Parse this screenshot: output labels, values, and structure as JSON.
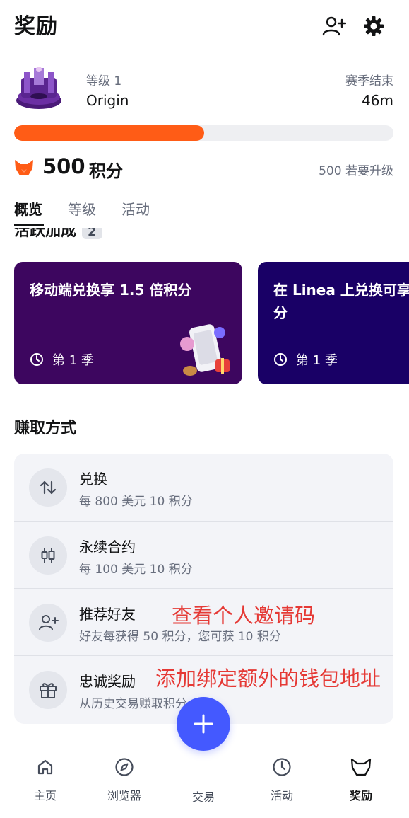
{
  "header": {
    "title": "奖励"
  },
  "level": {
    "label": "等级 1",
    "name": "Origin",
    "season_label": "赛季结束",
    "season_value": "46m",
    "progress_fraction": 0.5
  },
  "points": {
    "amount": "500",
    "unit": "积分",
    "upgrade_text": "500 若要升级"
  },
  "tabs": [
    {
      "label": "概览",
      "active": true
    },
    {
      "label": "等级",
      "active": false
    },
    {
      "label": "活动",
      "active": false
    }
  ],
  "active_bonus": {
    "title": "活跃加成",
    "count": "2"
  },
  "cards": [
    {
      "title": "移动端兑换享 1.5 倍积分",
      "season": "第 1 季",
      "color": "#3d065f"
    },
    {
      "title": "在 Linea 上兑换可享",
      "title_line2": "分",
      "season": "第 1 季",
      "color": "#190066"
    }
  ],
  "earn": {
    "title": "赚取方式",
    "items": [
      {
        "title": "兑换",
        "sub": "每 800 美元 10 积分",
        "icon": "swap-arrows-icon"
      },
      {
        "title": "永续合约",
        "sub": "每 100 美元 10 积分",
        "icon": "candlestick-icon"
      },
      {
        "title": "推荐好友",
        "sub": "好友每获得 50 积分，您可获 10 积分",
        "icon": "add-person-icon"
      },
      {
        "title": "忠诚奖励",
        "sub": "从历史交易赚取积分",
        "icon": "gift-icon"
      }
    ]
  },
  "annotations": {
    "referral": "查看个人邀请码",
    "loyalty": "添加绑定额外的钱包地址"
  },
  "nav": [
    {
      "label": "主页",
      "icon": "home-icon"
    },
    {
      "label": "浏览器",
      "icon": "compass-icon"
    },
    {
      "label": "交易",
      "icon": "plus-icon"
    },
    {
      "label": "活动",
      "icon": "clock-icon"
    },
    {
      "label": "奖励",
      "icon": "rewards-fox-icon"
    }
  ],
  "colors": {
    "accent_orange": "#ff5c16",
    "fab_blue": "#4459ff",
    "annotation_red": "#e53935"
  }
}
